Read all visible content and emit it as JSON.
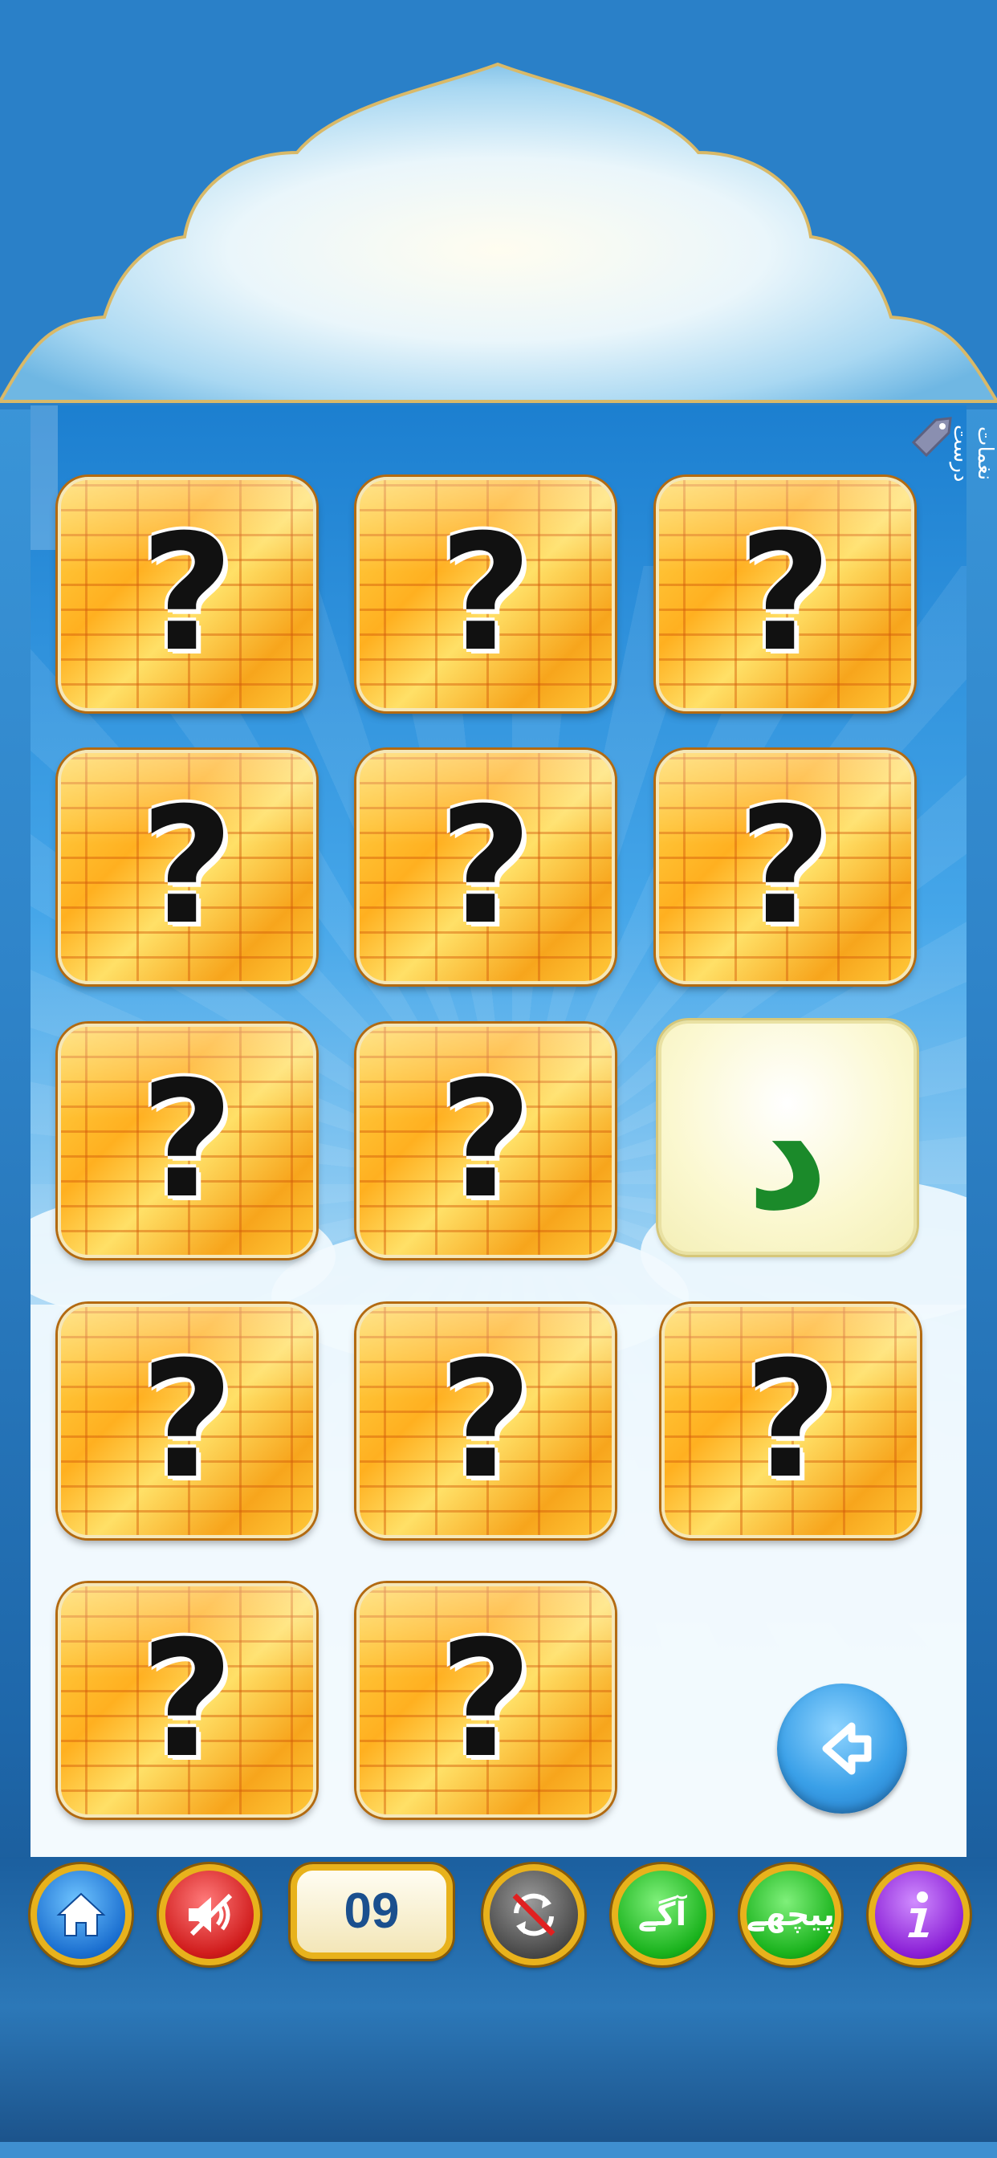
{
  "side_label": "نغمات درست",
  "cards": [
    {
      "face": "?",
      "revealed": false
    },
    {
      "face": "?",
      "revealed": false
    },
    {
      "face": "?",
      "revealed": false
    },
    {
      "face": "?",
      "revealed": false
    },
    {
      "face": "?",
      "revealed": false
    },
    {
      "face": "?",
      "revealed": false
    },
    {
      "face": "?",
      "revealed": false
    },
    {
      "face": "?",
      "revealed": false
    },
    {
      "face": "د",
      "revealed": true
    },
    {
      "face": "?",
      "revealed": false
    },
    {
      "face": "?",
      "revealed": false
    },
    {
      "face": "?",
      "revealed": false
    },
    {
      "face": "?",
      "revealed": false
    },
    {
      "face": "?",
      "revealed": false
    }
  ],
  "toolbar": {
    "counter": "09",
    "next_label": "آگے",
    "prev_label": "پیچھے"
  },
  "colors": {
    "accent_blue": "#1f78c4",
    "card_orange": "#ffb020",
    "letter_green": "#1b8a2a",
    "counter_text": "#1a4f8e"
  },
  "icons": [
    "home-icon",
    "sound-muted-icon",
    "repeat-off-icon",
    "info-icon",
    "back-arrow-icon",
    "tag-icon"
  ]
}
